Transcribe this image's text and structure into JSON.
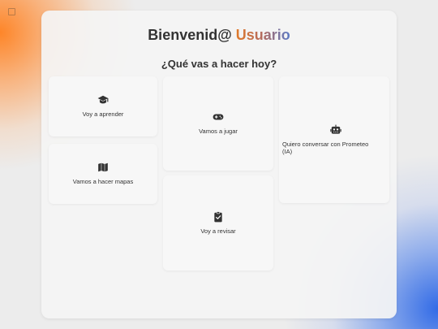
{
  "header": {
    "greeting": "Bienvenid@",
    "user": "Usuario"
  },
  "subtitle": "¿Qué vas a hacer hoy?",
  "cards": {
    "learn": {
      "label": "Voy a aprender",
      "icon": "graduation-cap-icon"
    },
    "maps": {
      "label": "Vamos a hacer mapas",
      "icon": "map-icon"
    },
    "play": {
      "label": "Vamos a jugar",
      "icon": "gamepad-icon"
    },
    "review": {
      "label": "Voy a revisar",
      "icon": "clipboard-check-icon"
    },
    "chat": {
      "label": "Quiero conversar con Prometeo (IA)",
      "icon": "robot-icon"
    }
  },
  "colors": {
    "user_gradient_start": "#e07a2a",
    "user_gradient_end": "#5a7ac8",
    "text": "#333333"
  }
}
